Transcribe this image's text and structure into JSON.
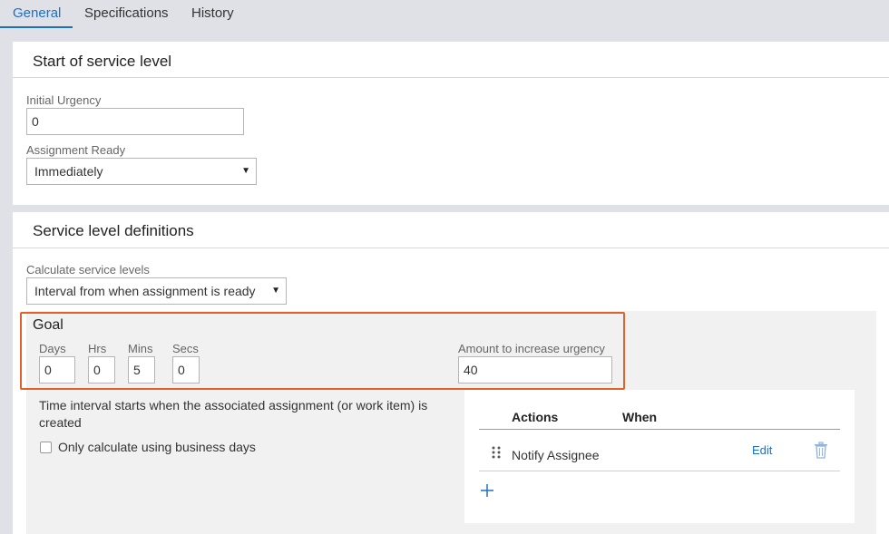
{
  "tabs": [
    {
      "label": "General",
      "active": true
    },
    {
      "label": "Specifications",
      "active": false
    },
    {
      "label": "History",
      "active": false
    }
  ],
  "start_section": {
    "title": "Start of service level",
    "initial_urgency": {
      "label": "Initial Urgency",
      "value": "0"
    },
    "assignment_ready": {
      "label": "Assignment Ready",
      "value": "Immediately"
    }
  },
  "definitions_section": {
    "title": "Service level definitions",
    "calculate": {
      "label": "Calculate service levels",
      "value": "Interval from when assignment is ready"
    }
  },
  "goal": {
    "title": "Goal",
    "days": {
      "label": "Days",
      "value": "0"
    },
    "hrs": {
      "label": "Hrs",
      "value": "0"
    },
    "mins": {
      "label": "Mins",
      "value": "5"
    },
    "secs": {
      "label": "Secs",
      "value": "0"
    },
    "urgency_increase": {
      "label": "Amount to increase urgency",
      "value": "40"
    },
    "note": "Time interval starts when the associated assignment (or work item) is created",
    "business_days": {
      "label": "Only calculate using business days",
      "checked": false
    }
  },
  "actions_table": {
    "headers": [
      "Actions",
      "When"
    ],
    "rows": [
      {
        "action": "Notify Assignee",
        "when": "",
        "edit_label": "Edit"
      }
    ]
  },
  "colors": {
    "accent": "#1f6fbf",
    "highlight": "#e0622a",
    "background": "#dfe1e6"
  }
}
